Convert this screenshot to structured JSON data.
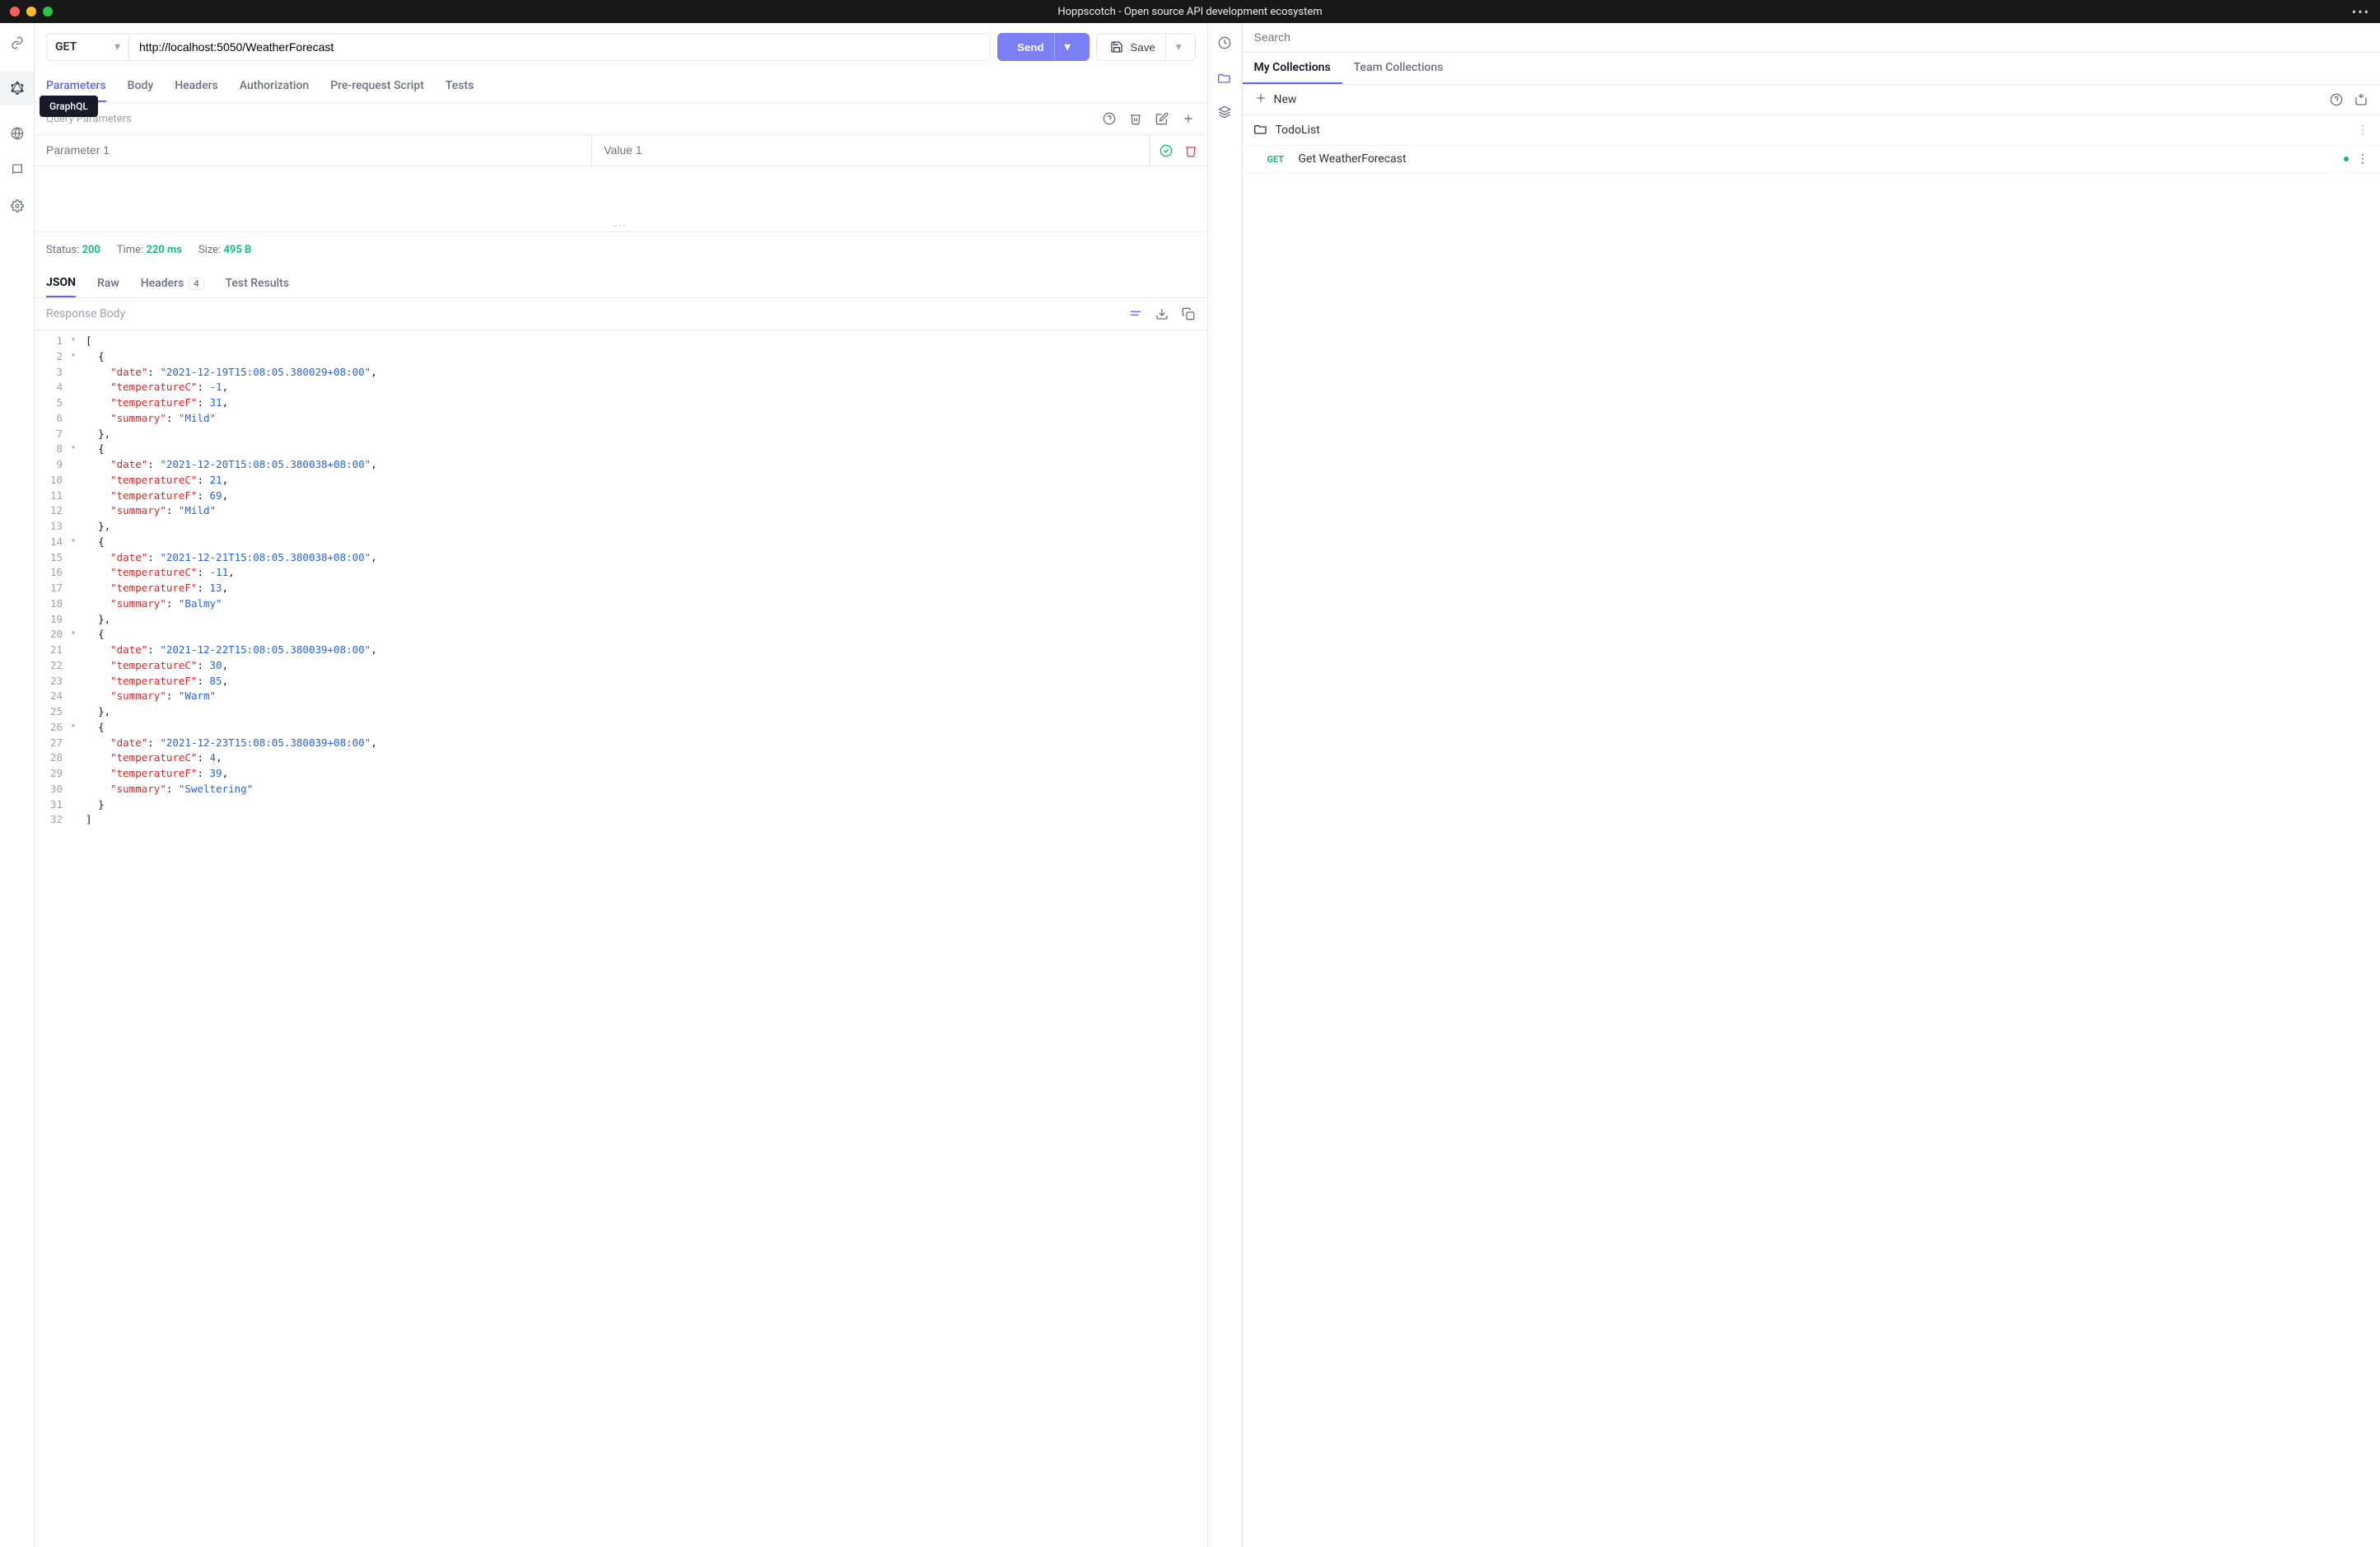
{
  "titlebar": {
    "title": "Hoppscotch - Open source API development ecosystem"
  },
  "left_rail": {
    "tooltip": "GraphQL"
  },
  "request": {
    "method": "GET",
    "url": "http://localhost:5050/WeatherForecast",
    "send_label": "Send",
    "save_label": "Save"
  },
  "tabs": {
    "parameters": "Parameters",
    "body": "Body",
    "headers": "Headers",
    "authorization": "Authorization",
    "pre_request": "Pre-request Script",
    "tests": "Tests"
  },
  "params": {
    "section_label": "Query Parameters",
    "key_placeholder": "Parameter 1",
    "value_placeholder": "Value 1"
  },
  "response": {
    "status_label": "Status:",
    "status_value": "200",
    "time_label": "Time:",
    "time_value": "220 ms",
    "size_label": "Size:",
    "size_value": "495 B",
    "tabs": {
      "json": "JSON",
      "raw": "Raw",
      "headers": "Headers",
      "headers_count": "4",
      "test_results": "Test Results"
    },
    "body_label": "Response Body",
    "json_data": [
      {
        "date": "2021-12-19T15:08:05.380029+08:00",
        "temperatureC": -1,
        "temperatureF": 31,
        "summary": "Mild"
      },
      {
        "date": "2021-12-20T15:08:05.380038+08:00",
        "temperatureC": 21,
        "temperatureF": 69,
        "summary": "Mild"
      },
      {
        "date": "2021-12-21T15:08:05.380038+08:00",
        "temperatureC": -11,
        "temperatureF": 13,
        "summary": "Balmy"
      },
      {
        "date": "2021-12-22T15:08:05.380039+08:00",
        "temperatureC": 30,
        "temperatureF": 85,
        "summary": "Warm"
      },
      {
        "date": "2021-12-23T15:08:05.380039+08:00",
        "temperatureC": 4,
        "temperatureF": 39,
        "summary": "Sweltering"
      }
    ]
  },
  "right_panel": {
    "search_placeholder": "Search",
    "tabs": {
      "my": "My Collections",
      "team": "Team Collections"
    },
    "new_label": "New",
    "collection": {
      "name": "TodoList",
      "requests": [
        {
          "method": "GET",
          "name": "Get WeatherForecast"
        }
      ]
    }
  }
}
